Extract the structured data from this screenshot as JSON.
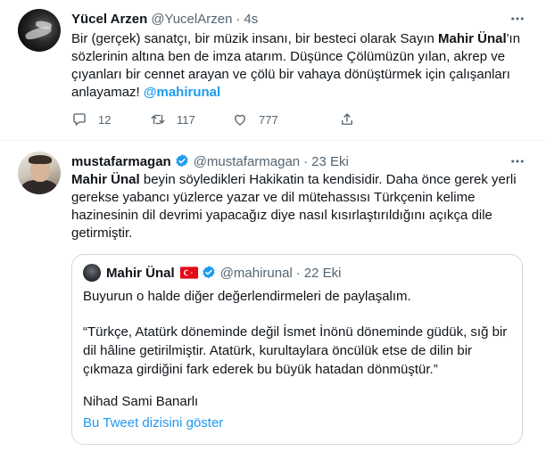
{
  "tweets": [
    {
      "name": "Yücel Arzen",
      "handle": "@YucelArzen",
      "dot": "·",
      "time": "4s",
      "text": {
        "part1": "Bir (gerçek) sanatçı, bir müzik insanı, bir besteci olarak Sayın ",
        "bold": "Mahir Ünal",
        "part2": "'ın sözlerinin altına ben de imza atarım. Düşünce Çölümüzün yılan, akrep ve çıyanları bir cennet arayan ve çölü bir vahaya dönüştürmek için çalışanları anlayamaz! ",
        "mention": "@mahirunal"
      },
      "actions": {
        "replies": "12",
        "retweets": "117",
        "likes": "777"
      },
      "icons": [
        "more-icon",
        "reply-icon",
        "retweet-icon",
        "like-icon",
        "share-icon"
      ]
    },
    {
      "name": "mustafarmagan",
      "handle": "@mustafarmagan",
      "dot": "·",
      "time": "23 Eki",
      "text": {
        "bold": "Mahir Ünal",
        "part1": " beyin söyledikleri  Hakikatin ta kendisidir. Daha önce gerek yerli gerekse yabancı yüzlerce yazar ve dil mütehassısı Türkçenin kelime hazinesinin dil devrimi yapacağız diye nasıl kısırlaştırıldığını açıkça dile getirmiştir."
      },
      "quote": {
        "name": "Mahir Ünal",
        "handle": "@mahirunal",
        "dot": "·",
        "time": "22 Eki",
        "para1": "Buyurun o halde diğer değerlendirmeleri de paylaşalım.",
        "para2": "“Türkçe, Atatürk döneminde değil İsmet İnönü döneminde güdük, sığ bir dil hâline getirilmiştir. Atatürk, kurultaylara öncülük etse de dilin bir çıkmaza girdiğini fark ederek bu büyük hatadan dönmüştür.”",
        "para3": "Nihad Sami Banarlı",
        "show_thread": "Bu Tweet dizisini göster"
      }
    }
  ],
  "colors": {
    "accent": "#1d9bf0",
    "secondary_text": "#536471",
    "border": "#cfd9de",
    "verified": "#1d9bf0",
    "flag": "#e30a17"
  }
}
